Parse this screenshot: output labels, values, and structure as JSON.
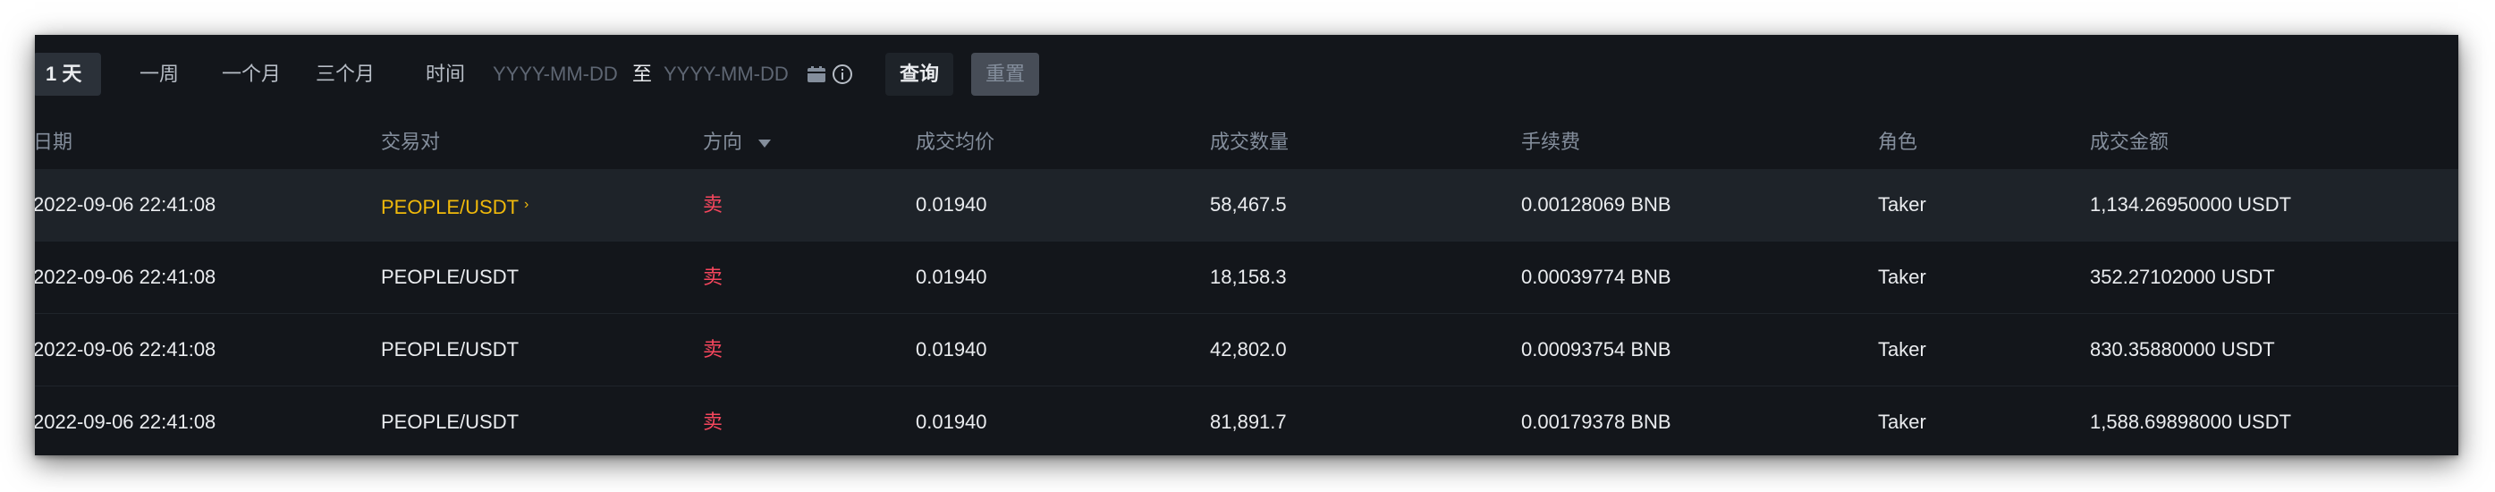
{
  "filters": {
    "periods": [
      "1 天",
      "一周",
      "一个月",
      "三个月"
    ],
    "time_label": "时间",
    "start_placeholder": "YYYY-MM-DD",
    "range_separator": "至",
    "end_placeholder": "YYYY-MM-DD",
    "query_label": "查询",
    "reset_label": "重置"
  },
  "table": {
    "columns": [
      "日期",
      "交易对",
      "方向",
      "成交均价",
      "成交数量",
      "手续费",
      "角色",
      "成交金额"
    ],
    "rows": [
      {
        "date": "2022-09-06 22:41:08",
        "pair": "PEOPLE/USDT",
        "side": "卖",
        "avg_price": "0.01940",
        "quantity": "58,467.5",
        "fee": "0.00128069 BNB",
        "role": "Taker",
        "amount": "1,134.26950000 USDT"
      },
      {
        "date": "2022-09-06 22:41:08",
        "pair": "PEOPLE/USDT",
        "side": "卖",
        "avg_price": "0.01940",
        "quantity": "18,158.3",
        "fee": "0.00039774 BNB",
        "role": "Taker",
        "amount": "352.27102000 USDT"
      },
      {
        "date": "2022-09-06 22:41:08",
        "pair": "PEOPLE/USDT",
        "side": "卖",
        "avg_price": "0.01940",
        "quantity": "42,802.0",
        "fee": "0.00093754 BNB",
        "role": "Taker",
        "amount": "830.35880000 USDT"
      },
      {
        "date": "2022-09-06 22:41:08",
        "pair": "PEOPLE/USDT",
        "side": "卖",
        "avg_price": "0.01940",
        "quantity": "81,891.7",
        "fee": "0.00179378 BNB",
        "role": "Taker",
        "amount": "1,588.69898000 USDT"
      }
    ]
  },
  "colors": {
    "background": "#13161b",
    "highlight_row": "#1e2329",
    "link": "#f0b90b",
    "sell": "#f6465d",
    "text": "#eaecef",
    "muted": "#848e9c"
  },
  "icons": [
    "calendar-icon",
    "info-icon",
    "sort-down-icon",
    "chevron-right-icon"
  ]
}
